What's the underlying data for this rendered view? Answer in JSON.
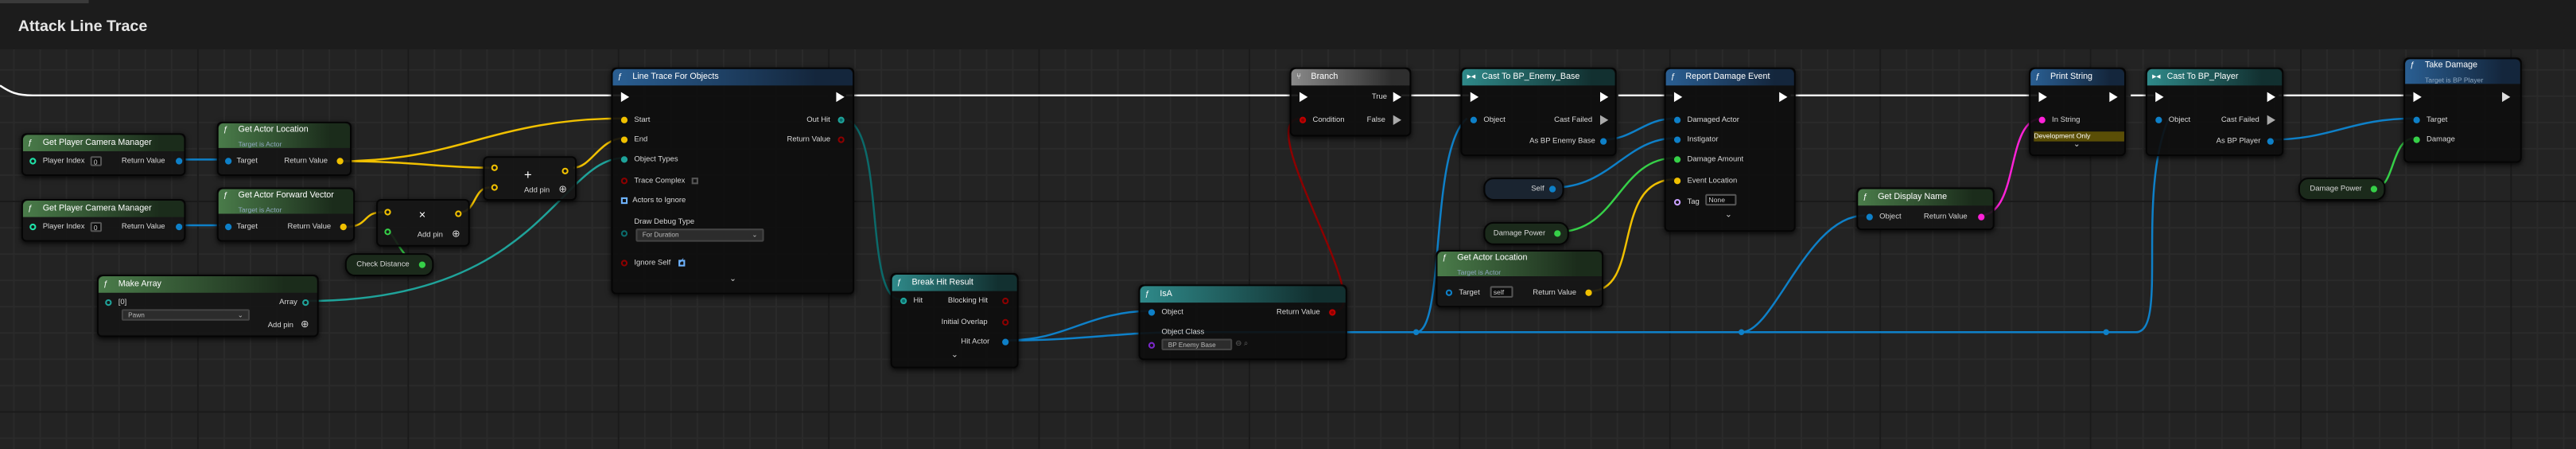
{
  "graph": {
    "title": "Attack Line Trace"
  },
  "colors": {
    "exec": "#ffffff",
    "object": "#0e80c8",
    "vector": "#f0c000",
    "bool": "#8c0000",
    "int": "#1fe2a8",
    "float": "#36d048",
    "string": "#ff22d8",
    "struct": "#0b6a6a"
  },
  "nodes": {
    "camera1": {
      "title": "Get Player Camera Manager",
      "pin_in": "Player Index",
      "pin_in_value": "0",
      "pin_out": "Return Value"
    },
    "camera2": {
      "title": "Get Player Camera Manager",
      "pin_in": "Player Index",
      "pin_in_value": "0",
      "pin_out": "Return Value"
    },
    "actor_location": {
      "title": "Get Actor Location",
      "subtitle": "Target is Actor",
      "pin_in": "Target",
      "pin_out": "Return Value"
    },
    "forward_vector": {
      "title": "Get Actor Forward Vector",
      "subtitle": "Target is Actor",
      "pin_in": "Target",
      "pin_out": "Return Value"
    },
    "add_node": {
      "symbol": "+",
      "add_pin": "Add pin"
    },
    "multiply_node": {
      "symbol": "×",
      "add_pin": "Add pin"
    },
    "check_distance": {
      "label": "Check Distance"
    },
    "make_array": {
      "title": "Make Array",
      "index": "[0]",
      "value": "Pawn",
      "out": "Array",
      "add_pin": "Add pin"
    },
    "line_trace": {
      "title": "Line Trace For Objects",
      "start": "Start",
      "end": "End",
      "object_types": "Object Types",
      "trace_complex": "Trace Complex",
      "actors_to_ignore": "Actors to Ignore",
      "draw_debug_type": "Draw Debug Type",
      "draw_debug_value": "For Duration",
      "ignore_self": "Ignore Self",
      "out_hit": "Out Hit",
      "return_value": "Return Value"
    },
    "break_hit": {
      "title": "Break Hit Result",
      "hit": "Hit",
      "blocking_hit": "Blocking Hit",
      "initial_overlap": "Initial Overlap",
      "hit_actor": "Hit Actor"
    },
    "isa": {
      "title": "IsA",
      "object": "Object",
      "return_value": "Return Value",
      "object_class": "Object Class",
      "class_value": "BP Enemy Base"
    },
    "branch": {
      "title": "Branch",
      "condition": "Condition",
      "true": "True",
      "false": "False"
    },
    "cast_enemy": {
      "title": "Cast To BP_Enemy_Base",
      "object": "Object",
      "cast_failed": "Cast Failed",
      "as_out": "As BP Enemy Base"
    },
    "self_node": {
      "label": "Self"
    },
    "damage_power1": {
      "label": "Damage Power"
    },
    "get_actor_location2": {
      "title": "Get Actor Location",
      "subtitle": "Target is Actor",
      "target": "Target",
      "target_value": "self",
      "return_value": "Return Value"
    },
    "report_damage": {
      "title": "Report Damage Event",
      "damaged_actor": "Damaged Actor",
      "instigator": "Instigator",
      "damage_amount": "Damage Amount",
      "event_location": "Event Location",
      "tag": "Tag",
      "tag_value": "None"
    },
    "display_name": {
      "title": "Get Display Name",
      "object": "Object",
      "return_value": "Return Value"
    },
    "print_string": {
      "title": "Print String",
      "in_string": "In String",
      "dev_only": "Development Only"
    },
    "cast_player": {
      "title": "Cast To BP_Player",
      "object": "Object",
      "cast_failed": "Cast Failed",
      "as_out": "As BP Player"
    },
    "take_damage": {
      "title": "Take Damage",
      "subtitle": "Target is BP Player",
      "target": "Target",
      "damage": "Damage"
    },
    "damage_power2": {
      "label": "Damage Power"
    }
  }
}
